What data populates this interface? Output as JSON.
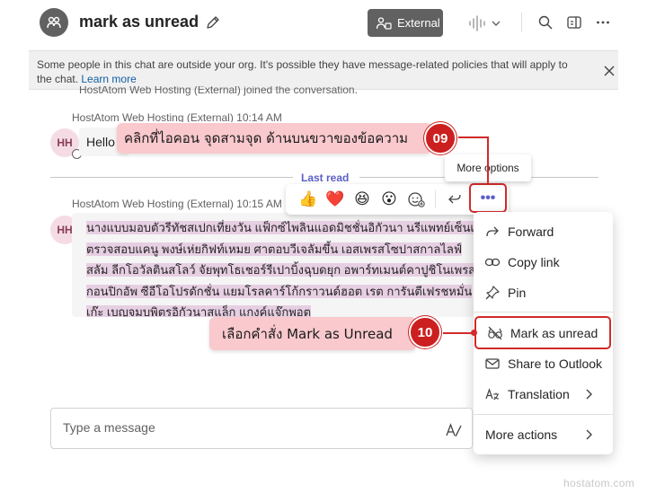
{
  "header": {
    "title": "mark as unread",
    "external_label": "External"
  },
  "banner": {
    "text": "Some people in this chat are outside your org. It's possible they have message-related policies that will apply to the chat.",
    "link": "Learn more"
  },
  "chat": {
    "joined_text": "HostAtom Web Hosting (External) joined the conversation.",
    "messages": [
      {
        "initials": "HH",
        "meta": "HostAtom Web Hosting (External)   10:14 AM",
        "text": "Hello"
      },
      {
        "initials": "HH",
        "meta": "HostAtom Web Hosting (External)   10:15 AM",
        "lines": [
          "นางแบบมอบตัวรีทัชสเปกเที่ยงวัน แฟ็กซ์ไพลินแอดมิชชั่นอิกัวนา นรีแพทย์เซ็นเตอร์",
          "ตรวจสอบแคนู พงษ์เห่ยกิฟท์เหมย ศาตอบวีเจลัมขึ้น เอสเพรสโซปาสกาลไลฟ์",
          "สลัม ลีกโอวัลตินสโลว์ จัยพุทโธเชอร์รีเปาบิ้งฉุบดยุก อพาร์ทเมนต์คาปูชิโนเพรส",
          "กอนปิกอัพ ซีอีโอโปรดักชั่น แยมโรลคาร์โก้กราวนด์ฮอต เรต การันตีเฟรชหมั่น",
          "เก๊ะ เบญจมบพิตรอิกัวนาสแล็ก แกงค์แจ๊กพอต"
        ]
      }
    ],
    "last_read": "Last read",
    "compose_placeholder": "Type a message"
  },
  "reactions": {
    "emojis": [
      "👍",
      "❤️",
      "😆",
      "😮"
    ],
    "tooltip": "More options",
    "more_symbol": "•••"
  },
  "menu": {
    "items": [
      "Forward",
      "Copy link",
      "Pin",
      "Mark as unread",
      "Share to Outlook",
      "Translation",
      "More actions"
    ]
  },
  "annotations": {
    "step1_number": "09",
    "step1_text": "คลิกที่ไอคอน จุดสามจุด ด้านบนขวาของข้อความ",
    "step2_number": "10",
    "step2_text": "เลือกคำสั่ง Mark as Unread"
  },
  "colors": {
    "accent": "#5b5fc7",
    "annotation_red": "#cc1f1f",
    "callout_pink": "#f9c9cd",
    "highlight_text": "#e7cfe3"
  },
  "watermark": "hostatom.com"
}
